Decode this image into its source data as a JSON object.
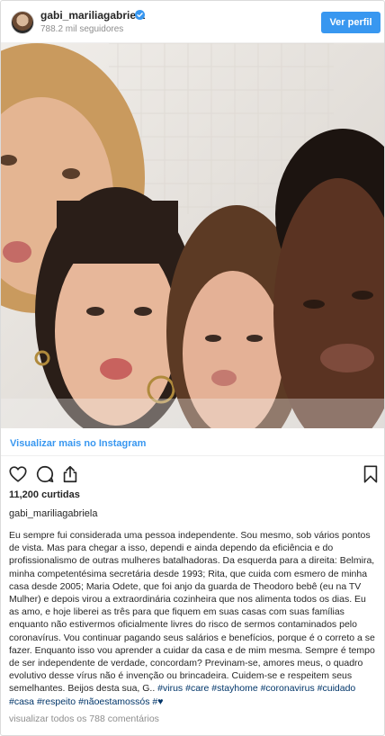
{
  "header": {
    "username": "gabi_mariliagabriela",
    "followers": "788.2 mil seguidores",
    "view_profile_label": "Ver perfil",
    "verified_badge_color": "#3897f0",
    "verified_icon": "verified-badge-icon"
  },
  "post": {
    "image_alt": "Selfie de quatro mulheres fazendo bico de beijo",
    "more_link": "Visualizar mais no Instagram",
    "likes": "11,200 curtidas",
    "caption_username": "gabi_mariliagabriela",
    "caption_text": "Eu sempre fui considerada uma pessoa independente. Sou mesmo, sob vários pontos de vista. Mas para chegar a isso, dependi e ainda dependo da eficiência e do profissionalismo de outras mulheres batalhadoras. Da esquerda para a direita: Belmira, minha competentésima secretária desde 1993; Rita, que cuida com esmero de minha casa desde 2005; Maria Odete, que foi anjo da guarda de Theodoro bebê (eu na TV Mulher) e depois virou a extraordinária cozinheira que nos alimenta todos os dias. Eu as amo, e hoje liberei as três para que fiquem em suas casas com suas famílias enquanto não estivermos oficialmente livres do risco de sermos contaminados pelo coronavírus. Vou continuar pagando seus salários e benefícios, porque é o correto a se fazer. Enquanto isso vou aprender a cuidar da casa e de mim mesma. Sempre é tempo de ser independente de verdade, concordam? Previnam-se, amores meus, o quadro evolutivo desse vírus não é invenção ou brincadeira. Cuidem-se e respeitem seus semelhantes. Beijos desta sua, G.. ",
    "hashtags": [
      "#virus",
      "#care",
      "#stayhome",
      "#coronavirus",
      "#cuidado",
      "#casa",
      "#respeito",
      "#nãoestamossós",
      "#♥"
    ],
    "view_comments": "visualizar todos os 788 comentários"
  },
  "icons": {
    "like": "heart-outline-icon",
    "comment": "comment-bubble-icon",
    "share": "share-upload-icon",
    "save": "bookmark-icon"
  },
  "colors": {
    "accent": "#3897f0",
    "hashtag": "#003569",
    "muted": "#8e8e8e",
    "text": "#262626"
  }
}
